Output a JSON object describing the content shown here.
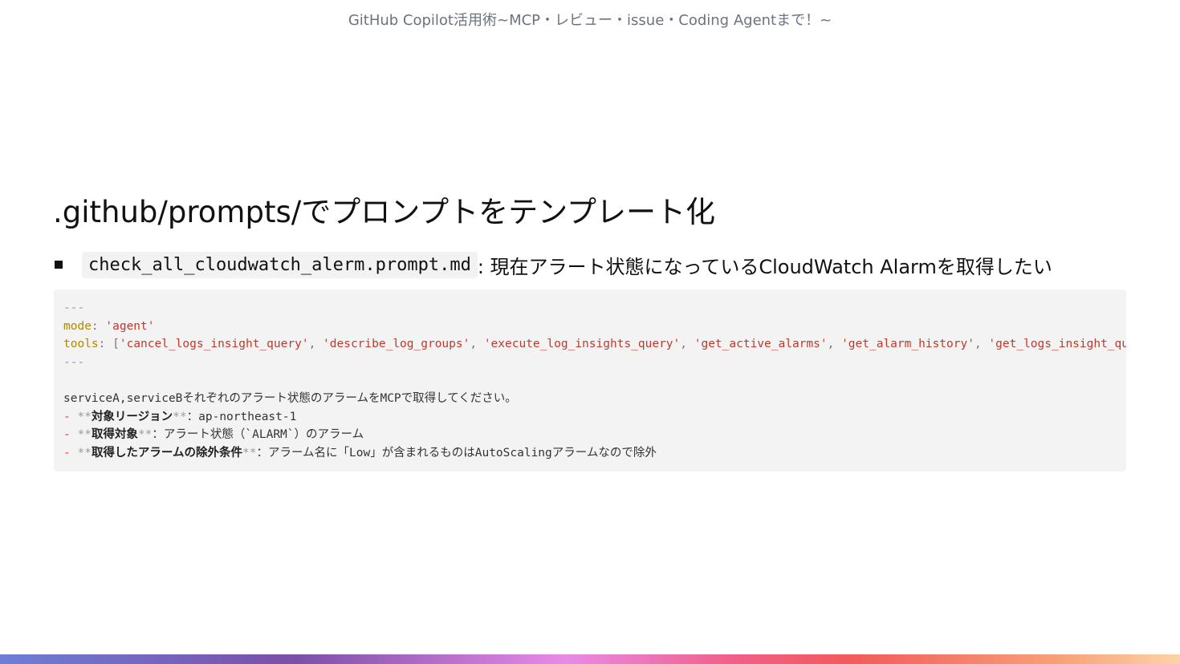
{
  "header": {
    "text": "GitHub Copilot活用術~MCP・レビュー・issue・Coding Agentまで！~"
  },
  "slide": {
    "title": ".github/prompts/でプロンプトをテンプレート化",
    "bullet": {
      "code": "check_all_cloudwatch_alerm.prompt.md",
      "text": ": 現在アラート状態になっているCloudWatch Alarmを取得したい"
    }
  },
  "code": {
    "line1": "---",
    "mode_key": "mode",
    "mode_colon": ": ",
    "mode_value": "'agent'",
    "tools_key": "tools",
    "tools_open": ": [",
    "tools": [
      "'cancel_logs_insight_query'",
      "'describe_log_groups'",
      "'execute_log_insights_query'",
      "'get_active_alarms'",
      "'get_alarm_history'",
      "'get_logs_insight_query_results'"
    ],
    "tools_sep": ", ",
    "line4": "---",
    "body_text": "serviceA,serviceBそれぞれのアラート状態のアラームをMCPで取得してください。",
    "list_marker": "- ",
    "em_marker": "**",
    "item1_label": "対象リージョン",
    "item1_value": "：ap-northeast-1",
    "item2_label": "取得対象",
    "item2_value": "：アラート状態（`ALARM`）のアラーム",
    "item3_label": "取得したアラームの除外条件",
    "item3_value": "：アラーム名に「Low」が含まれるものはAutoScalingアラームなので除外"
  }
}
